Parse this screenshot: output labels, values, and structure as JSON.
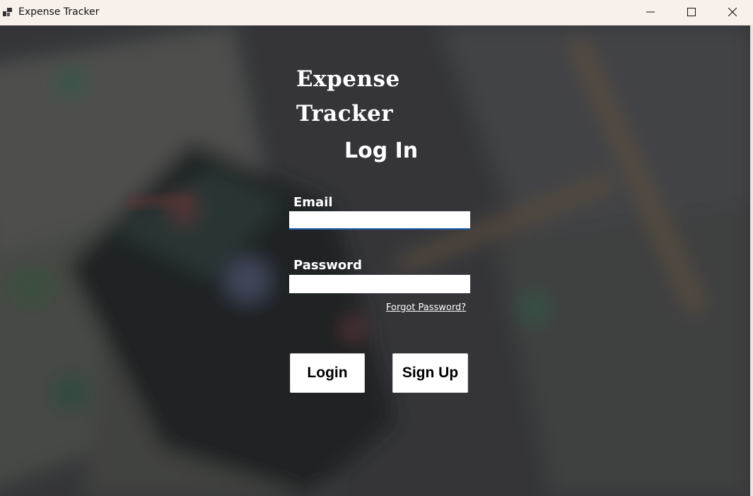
{
  "window": {
    "title": "Expense Tracker",
    "icon": "app-window-icon",
    "controls": {
      "minimize": "minimize-icon",
      "maximize": "maximize-icon",
      "close": "close-icon"
    }
  },
  "form": {
    "app_title": "Expense Tracker",
    "heading": "Log In",
    "email_label": "Email",
    "email_value": "",
    "password_label": "Password",
    "password_value": "",
    "forgot_password": "Forgot Password?",
    "login_button": "Login",
    "signup_button": "Sign Up"
  },
  "colors": {
    "titlebar": "#f8f0ea",
    "background_dim": "#3a3b3e",
    "text": "#ffffff",
    "input_focus_accent": "#1f5fb3"
  }
}
